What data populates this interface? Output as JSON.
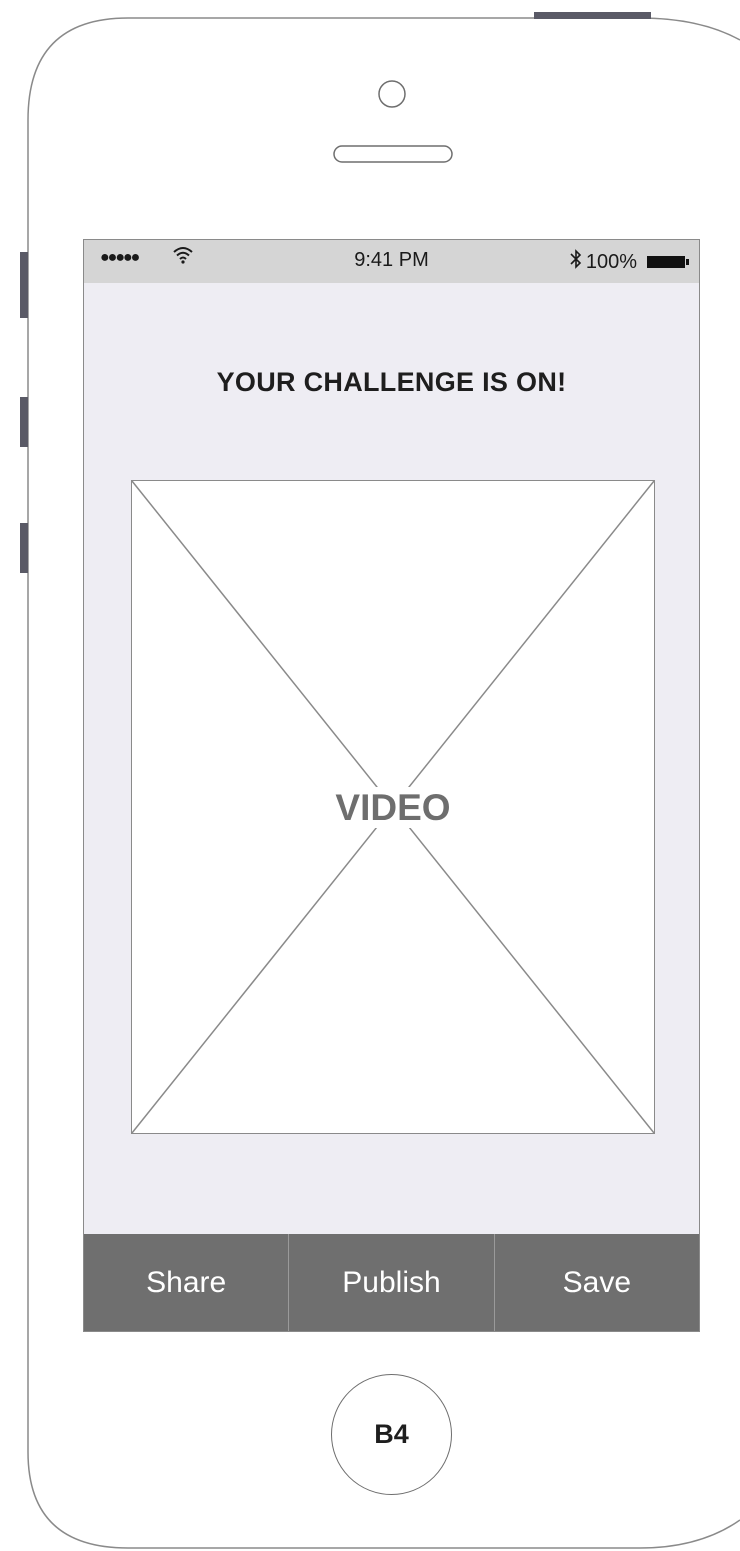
{
  "status_bar": {
    "signal": "●●●●●",
    "wifi_icon": "wifi-icon",
    "time": "9:41 PM",
    "bluetooth_icon": "bluetooth-icon",
    "battery_text": "100%"
  },
  "main": {
    "title": "YOUR CHALLENGE IS ON!",
    "video_placeholder_label": "VIDEO"
  },
  "action_bar": {
    "share_label": "Share",
    "publish_label": "Publish",
    "save_label": "Save"
  },
  "home_button": {
    "label": "B4"
  },
  "colors": {
    "screen_background": "#eeedf3",
    "status_bar_background": "#d5d5d5",
    "action_bar_background": "#6f6f6f",
    "outline": "#8a8a8a"
  }
}
